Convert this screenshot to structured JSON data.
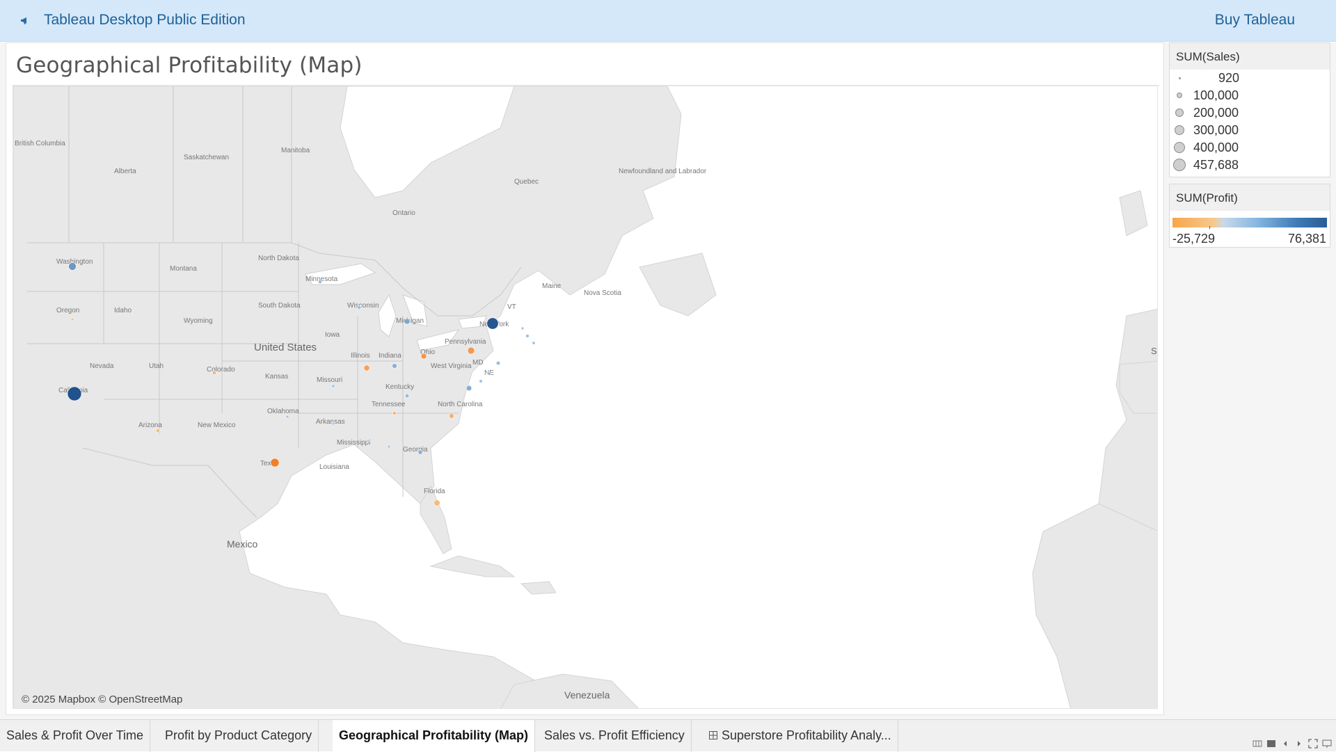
{
  "banner": {
    "app_title": "Tableau Desktop Public Edition",
    "buy_label": "Buy Tableau",
    "icon": "megaphone-icon"
  },
  "sheet": {
    "title": "Geographical Profitability (Map)"
  },
  "map": {
    "attribution": "© 2025 Mapbox © OpenStreetMap",
    "place_labels": [
      "British Columbia",
      "Alberta",
      "Saskatchewan",
      "Manitoba",
      "Ontario",
      "Quebec",
      "Newfoundland and Labrador",
      "Nova Scotia",
      "Washington",
      "Oregon",
      "Idaho",
      "Montana",
      "Wyoming",
      "North Dakota",
      "South Dakota",
      "Minnesota",
      "Wisconsin",
      "Michigan",
      "Iowa",
      "Nevada",
      "Utah",
      "Colorado",
      "California",
      "Arizona",
      "New Mexico",
      "Kansas",
      "Missouri",
      "Illinois",
      "Indiana",
      "Ohio",
      "Pennsylvania",
      "New York",
      "Kentucky",
      "West Virginia",
      "Tennessee",
      "North Carolina",
      "Oklahoma",
      "Arkansas",
      "Mississippi",
      "Georgia",
      "Louisiana",
      "Texas",
      "Florida",
      "Maine",
      "VT",
      "NE",
      "MD",
      "United States",
      "Mexico",
      "Venezuela",
      "S"
    ],
    "marks": [
      {
        "state": "California",
        "sales": 457688,
        "profit": 76381
      },
      {
        "state": "New York",
        "sales": 310876,
        "profit": 74039
      },
      {
        "state": "Texas",
        "sales": 170188,
        "profit": -25729
      },
      {
        "state": "Pennsylvania",
        "sales": 116512,
        "profit": -15560
      },
      {
        "state": "Washington",
        "sales": 138641,
        "profit": 33403
      },
      {
        "state": "Illinois",
        "sales": 80166,
        "profit": -12608
      },
      {
        "state": "Ohio",
        "sales": 78258,
        "profit": -16971
      },
      {
        "state": "Florida",
        "sales": 89474,
        "profit": -3399
      },
      {
        "state": "Michigan",
        "sales": 76270,
        "profit": 24463
      },
      {
        "state": "North Carolina",
        "sales": 55603,
        "profit": -7491
      },
      {
        "state": "Virginia",
        "sales": 70637,
        "profit": 18598
      },
      {
        "state": "Georgia",
        "sales": 49096,
        "profit": 16250
      },
      {
        "state": "Indiana",
        "sales": 53555,
        "profit": 18383
      },
      {
        "state": "Kentucky",
        "sales": 36592,
        "profit": 11200
      },
      {
        "state": "New Jersey",
        "sales": 35764,
        "profit": 9773
      },
      {
        "state": "Minnesota",
        "sales": 29863,
        "profit": 10823
      },
      {
        "state": "Wisconsin",
        "sales": 32115,
        "profit": 8402
      },
      {
        "state": "Tennessee",
        "sales": 30662,
        "profit": -5342
      },
      {
        "state": "Colorado",
        "sales": 32108,
        "profit": -6528
      },
      {
        "state": "Arizona",
        "sales": 35282,
        "profit": -3428
      },
      {
        "state": "Massachusetts",
        "sales": 28634,
        "profit": 6786
      },
      {
        "state": "Rhode Island",
        "sales": 22628,
        "profit": 7286
      },
      {
        "state": "Maryland",
        "sales": 23706,
        "profit": 7031
      },
      {
        "state": "Delaware",
        "sales": 27451,
        "profit": 9977
      },
      {
        "state": "Alabama",
        "sales": 19511,
        "profit": 5787
      },
      {
        "state": "Missouri",
        "sales": 22205,
        "profit": 6436
      },
      {
        "state": "Oklahoma",
        "sales": 19683,
        "profit": 4854
      },
      {
        "state": "Arkansas",
        "sales": 11678,
        "profit": 4009
      },
      {
        "state": "Mississippi",
        "sales": 10771,
        "profit": 3172
      },
      {
        "state": "Oregon",
        "sales": 17431,
        "profit": -1190
      },
      {
        "state": "Connecticut",
        "sales": 13384,
        "profit": 3511
      }
    ]
  },
  "size_legend": {
    "title": "SUM(Sales)",
    "items": [
      "920",
      "100,000",
      "200,000",
      "300,000",
      "400,000",
      "457,688"
    ],
    "values": [
      920,
      100000,
      200000,
      300000,
      400000,
      457688
    ]
  },
  "color_legend": {
    "title": "SUM(Profit)",
    "min": "-25,729",
    "max": "76,381",
    "colors": {
      "negative": "#f8a64a",
      "neutral": "#c7d9ea",
      "positive": "#2a5d95"
    }
  },
  "tabs": [
    {
      "label": "Sales & Profit Over Time",
      "active": false
    },
    {
      "label": "Profit by Product Category",
      "active": false
    },
    {
      "label": "Geographical Profitability (Map)",
      "active": true
    },
    {
      "label": "Sales vs. Profit Efficiency",
      "active": false
    },
    {
      "label": "Superstore Profitability Analy...",
      "active": false,
      "icon": "dashboard-grid-icon"
    }
  ]
}
